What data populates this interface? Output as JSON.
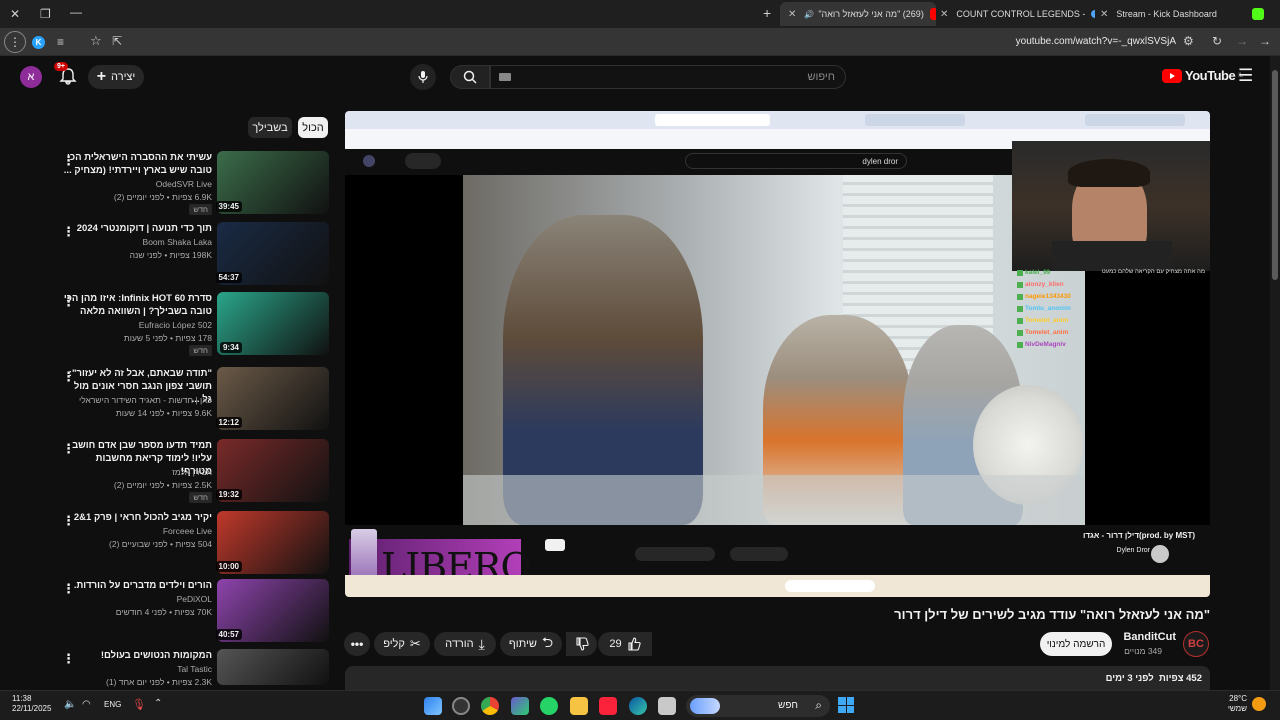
{
  "browser": {
    "tabs": [
      {
        "label": "Stream - Kick Dashboard",
        "color": "#53fc18"
      },
      {
        "label": "COUNT CONTROL LEGENDS -",
        "color": "#4ea1f3"
      },
      {
        "label": "(269) \"מה אני לעזאזל רואה\"",
        "color": "#ff0000"
      }
    ],
    "url": "youtube.com/watch?v=-_qwxlSVSjA"
  },
  "header": {
    "logo": "YouTube",
    "logo_sup": "IL",
    "search_placeholder": "חיפוש",
    "create_label": "יצירה",
    "notif_count": "9+",
    "avatar_letter": "א"
  },
  "chips": {
    "all": "הכול",
    "live": "בשבילך"
  },
  "related": [
    {
      "title": "עשיתי את ההסברה הישראלית הכי טובה שיש בארץ ויירדתי! (מצחיק ...",
      "channel": "OdedSVR Live",
      "meta": "6.9K צפיות • לפני יומיים (2)",
      "badge": "חדש",
      "duration": "39:45",
      "color": "#3b6d4a"
    },
    {
      "title": "תוך כדי תנועה | דוקומנטרי 2024",
      "channel": "Boom Shaka Laka",
      "meta": "198K צפיות • לפני שנה",
      "badge": "",
      "duration": "54:37",
      "color": "#1a2b45"
    },
    {
      "title": "סדרת Infinix HOT 60: איזו מהן הכי טובה בשבילך? | השוואה מלאה",
      "channel": "Eufracio López 502",
      "meta": "178 צפיות • לפני 5 שעות",
      "badge": "חדש",
      "duration": "9:34",
      "color": "#2aa68a"
    },
    {
      "title": "\"תודה שבאתם, אבל זה לא יעזור\": תושבי צפון הנגב חסרי אונים מול גל ...",
      "channel": "כאן | חדשות - תאגיד השידור הישראלי",
      "meta": "9.6K צפיות • לפני 14 שעות",
      "badge": "",
      "duration": "12:12",
      "color": "#6b5a48"
    },
    {
      "title": "תמיד תדעו מספר שבן אדם חושב עליו! לימוד קריאת מחשבות מטורף!",
      "channel": "אבירן אלמז",
      "meta": "2.5K צפיות • לפני יומיים (2)",
      "badge": "חדש",
      "duration": "19:32",
      "color": "#7a2a2a"
    },
    {
      "title": "יקיר מגיב להכול חראי | פרק 1&2",
      "channel": "Forceee Live",
      "meta": "504 צפיות • לפני שבועיים (2)",
      "badge": "",
      "duration": "10:00",
      "color": "#c0392b"
    },
    {
      "title": "הורים וילדים מדברים על הורדות.",
      "channel": "PeDiXOL",
      "meta": "70K צפיות • לפני 4 חודשים",
      "badge": "",
      "duration": "40:57",
      "color": "#8e44ad"
    },
    {
      "title": "המקומות הנטושים בעולם!",
      "channel": "Tal Tastic",
      "meta": "2.3K צפיות • לפני יום אחד (1)",
      "badge": "",
      "duration": "",
      "color": "#555555"
    }
  ],
  "player": {
    "inner_channel": "Dylen Dror",
    "inner_title": "דילן דרור - אגדו(prod. by MST)",
    "inner_search": "dylen dror",
    "ad_text": "LIBERO",
    "chat": [
      "kalel_99",
      "alonzy_klien",
      "nageie1343430",
      "Tomlu_anonim",
      "Tomelet_anim",
      "Tomelet_anim",
      "NivDeMagniv"
    ],
    "overlay_msg": "מה אתה מצחיק עם הקריאה שלהם כמעט"
  },
  "video": {
    "title": "\"מה אני לעזאזל רואה\" עודד מגיב לשירים של דילן דרור",
    "channel": "BanditCut",
    "subs": "349 מנויים",
    "subscribe": "הרשמה למינוי",
    "likes": "29",
    "share": "שיתוף",
    "download": "הורדה",
    "clip": "קליפ",
    "views": "452 צפיות",
    "date": "לפני 3 ימים"
  },
  "taskbar": {
    "time": "11:38",
    "date": "22/11/2025",
    "lang": "ENG",
    "temp": "28°C",
    "weather": "שמשי",
    "search": "חפש"
  }
}
